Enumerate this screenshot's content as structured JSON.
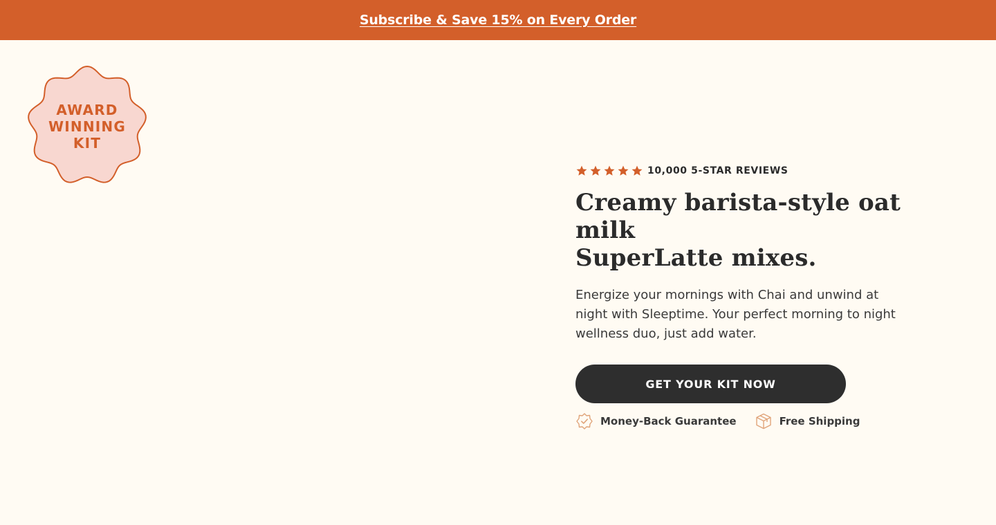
{
  "announcement": {
    "text": "Subscribe & Save 15% on Every Order"
  },
  "badge": {
    "lines": [
      "AWARD",
      "WINNING",
      "KIT"
    ]
  },
  "rating": {
    "stars": 5,
    "text": "10,000 5-STAR REVIEWS"
  },
  "hero": {
    "headline_line1": "Creamy barista-style oat milk",
    "headline_line2": "SuperLatte mixes.",
    "subtext": "Energize your mornings with Chai and unwind at night with Sleeptime. Your perfect morning to night wellness duo, just add water.",
    "cta_label": "GET YOUR KIT NOW"
  },
  "perks": [
    {
      "icon": "badge-check-icon",
      "label": "Money-Back Guarantee"
    },
    {
      "icon": "package-box-icon",
      "label": "Free Shipping"
    }
  ],
  "colors": {
    "accent": "#D35F2A",
    "background": "#FFFBF3",
    "badge_fill": "#F8D7D0",
    "dark": "#2E2E2E"
  }
}
